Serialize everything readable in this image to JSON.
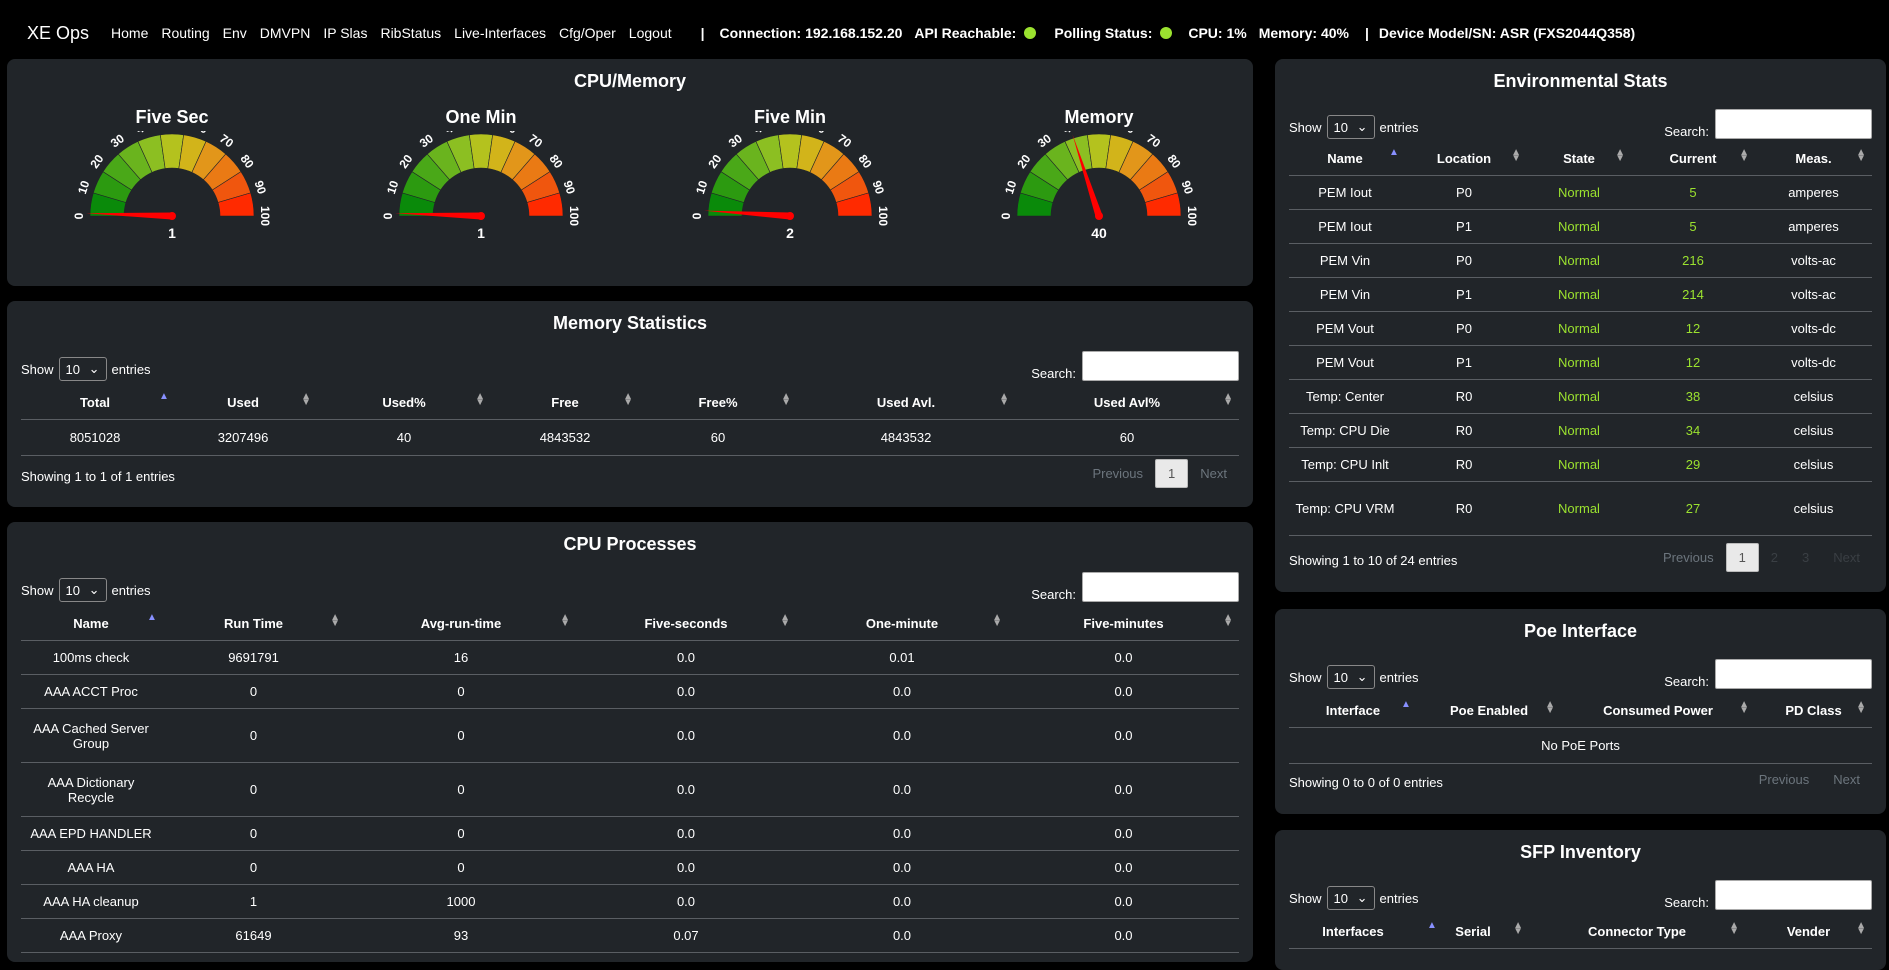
{
  "nav": {
    "brand": "XE Ops",
    "links": [
      "Home",
      "Routing",
      "Env",
      "DMVPN",
      "IP Slas",
      "RibStatus",
      "Live-Interfaces",
      "Cfg/Oper",
      "Logout"
    ],
    "connection": "Connection: 192.168.152.20",
    "api_label": "API Reachable:",
    "polling_label": "Polling Status:",
    "cpu": "CPU: 1%",
    "memory": "Memory: 40%",
    "device": "Device Model/SN: ASR (FXS2044Q358)",
    "separator": "|"
  },
  "colors": {
    "status_ok": "#9be22f",
    "panel_bg": "#212529",
    "normal_green": "#9be22f",
    "needle": "#ff0000"
  },
  "cpu_memory": {
    "title": "CPU/Memory",
    "gauges": [
      {
        "title": "Five Sec",
        "value": 1
      },
      {
        "title": "One Min",
        "value": 1
      },
      {
        "title": "Five Min",
        "value": 2
      },
      {
        "title": "Memory",
        "value": 40
      }
    ],
    "ticks": [
      "0",
      "10",
      "20",
      "30",
      "40",
      "50",
      "60",
      "70",
      "80",
      "90",
      "100"
    ]
  },
  "common": {
    "show": "Show",
    "entries": "entries",
    "search": "Search:",
    "select_value": "10",
    "previous": "Previous",
    "next": "Next"
  },
  "memory_stats": {
    "title": "Memory Statistics",
    "columns": [
      "Total",
      "Used",
      "Used%",
      "Free",
      "Free%",
      "Used Avl.",
      "Used Avl%"
    ],
    "rows": [
      [
        "8051028",
        "3207496",
        "40",
        "4843532",
        "60",
        "4843532",
        "60"
      ]
    ],
    "info": "Showing 1 to 1 of 1 entries",
    "pages": [
      "1"
    ]
  },
  "cpu_processes": {
    "title": "CPU Processes",
    "columns": [
      "Name",
      "Run Time",
      "Avg-run-time",
      "Five-seconds",
      "One-minute",
      "Five-minutes"
    ],
    "rows": [
      [
        "100ms check",
        "9691791",
        "16",
        "0.0",
        "0.01",
        "0.0"
      ],
      [
        "AAA ACCT Proc",
        "0",
        "0",
        "0.0",
        "0.0",
        "0.0"
      ],
      [
        "AAA Cached Server Group",
        "0",
        "0",
        "0.0",
        "0.0",
        "0.0"
      ],
      [
        "AAA Dictionary Recycle",
        "0",
        "0",
        "0.0",
        "0.0",
        "0.0"
      ],
      [
        "AAA EPD HANDLER",
        "0",
        "0",
        "0.0",
        "0.0",
        "0.0"
      ],
      [
        "AAA HA",
        "0",
        "0",
        "0.0",
        "0.0",
        "0.0"
      ],
      [
        "AAA HA cleanup",
        "1",
        "1000",
        "0.0",
        "0.0",
        "0.0"
      ],
      [
        "AAA Proxy",
        "61649",
        "93",
        "0.07",
        "0.0",
        "0.0"
      ]
    ]
  },
  "env_stats": {
    "title": "Environmental Stats",
    "columns": [
      "Name",
      "Location",
      "State",
      "Current",
      "Meas."
    ],
    "rows": [
      [
        "PEM Iout",
        "P0",
        "Normal",
        "5",
        "amperes"
      ],
      [
        "PEM Iout",
        "P1",
        "Normal",
        "5",
        "amperes"
      ],
      [
        "PEM Vin",
        "P0",
        "Normal",
        "216",
        "volts-ac"
      ],
      [
        "PEM Vin",
        "P1",
        "Normal",
        "214",
        "volts-ac"
      ],
      [
        "PEM Vout",
        "P0",
        "Normal",
        "12",
        "volts-dc"
      ],
      [
        "PEM Vout",
        "P1",
        "Normal",
        "12",
        "volts-dc"
      ],
      [
        "Temp: Center",
        "R0",
        "Normal",
        "38",
        "celsius"
      ],
      [
        "Temp: CPU Die",
        "R0",
        "Normal",
        "34",
        "celsius"
      ],
      [
        "Temp: CPU Inlt",
        "R0",
        "Normal",
        "29",
        "celsius"
      ],
      [
        "Temp: CPU VRM",
        "R0",
        "Normal",
        "27",
        "celsius"
      ]
    ],
    "info": "Showing 1 to 10 of 24 entries",
    "pages": [
      "1",
      "2",
      "3"
    ]
  },
  "poe": {
    "title": "Poe Interface",
    "columns": [
      "Interface",
      "Poe Enabled",
      "Consumed Power",
      "PD Class"
    ],
    "empty": "No PoE Ports",
    "info": "Showing 0 to 0 of 0 entries"
  },
  "sfp": {
    "title": "SFP Inventory",
    "columns": [
      "Interfaces",
      "Serial",
      "Connector Type",
      "Vender"
    ]
  }
}
